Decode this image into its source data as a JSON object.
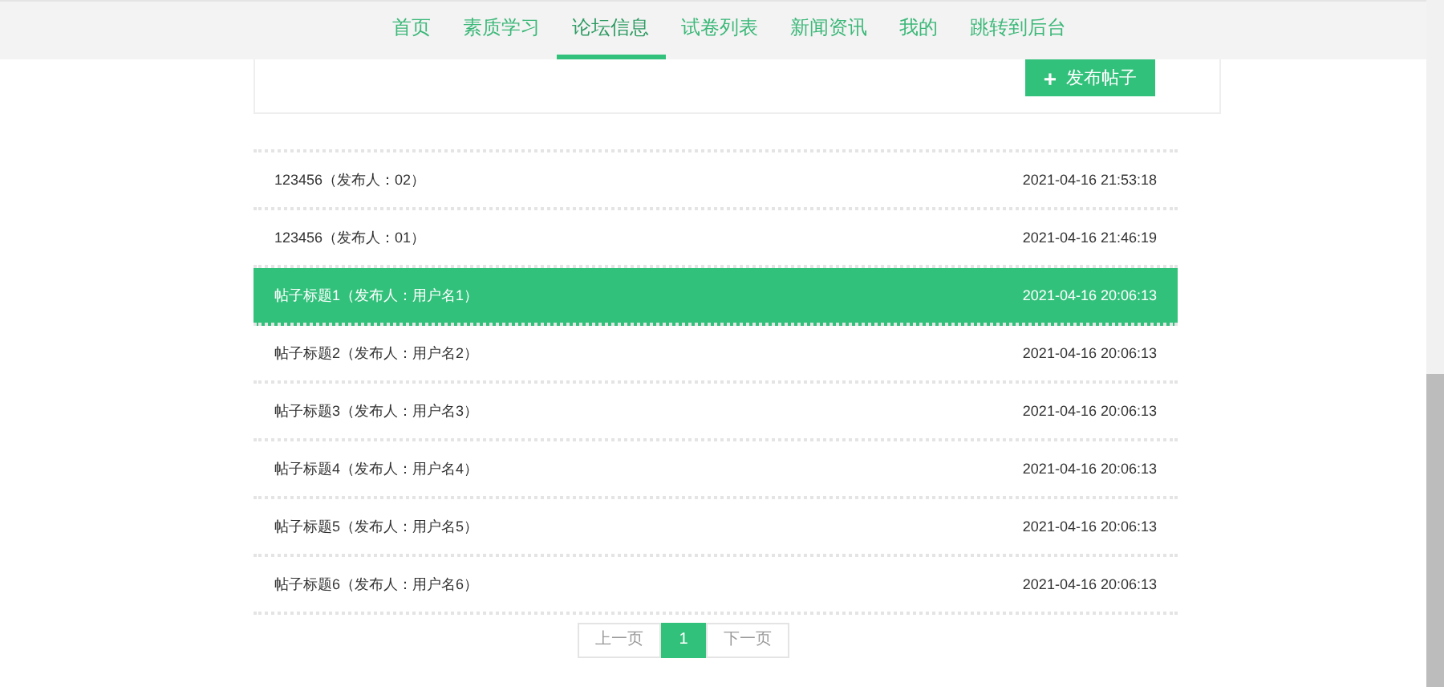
{
  "nav": [
    {
      "label": "首页",
      "selected": false
    },
    {
      "label": "素质学习",
      "selected": false
    },
    {
      "label": "论坛信息",
      "selected": true
    },
    {
      "label": "试卷列表",
      "selected": false
    },
    {
      "label": "新闻资讯",
      "selected": false
    },
    {
      "label": "我的",
      "selected": false
    },
    {
      "label": "跳转到后台",
      "selected": false
    }
  ],
  "toolbar": {
    "button": {
      "icon": "+",
      "label": "发布帖子"
    }
  },
  "posts": [
    {
      "title": "123456（发布人：02）",
      "time": "2021-04-16 21:53:18",
      "selected": false
    },
    {
      "title": "123456（发布人：01）",
      "time": "2021-04-16 21:46:19",
      "selected": false
    },
    {
      "title": "帖子标题1（发布人：用户名1）",
      "time": "2021-04-16 20:06:13",
      "selected": true
    },
    {
      "title": "帖子标题2（发布人：用户名2）",
      "time": "2021-04-16 20:06:13",
      "selected": false
    },
    {
      "title": "帖子标题3（发布人：用户名3）",
      "time": "2021-04-16 20:06:13",
      "selected": false
    },
    {
      "title": "帖子标题4（发布人：用户名4）",
      "time": "2021-04-16 20:06:13",
      "selected": false
    },
    {
      "title": "帖子标题5（发布人：用户名5）",
      "time": "2021-04-16 20:06:13",
      "selected": false
    },
    {
      "title": "帖子标题6（发布人：用户名6）",
      "time": "2021-04-16 20:06:13",
      "selected": false
    }
  ],
  "pagination": [
    {
      "label": "上一页",
      "selected": false
    },
    {
      "label": "1",
      "selected": true
    },
    {
      "label": "下一页",
      "selected": false
    }
  ]
}
